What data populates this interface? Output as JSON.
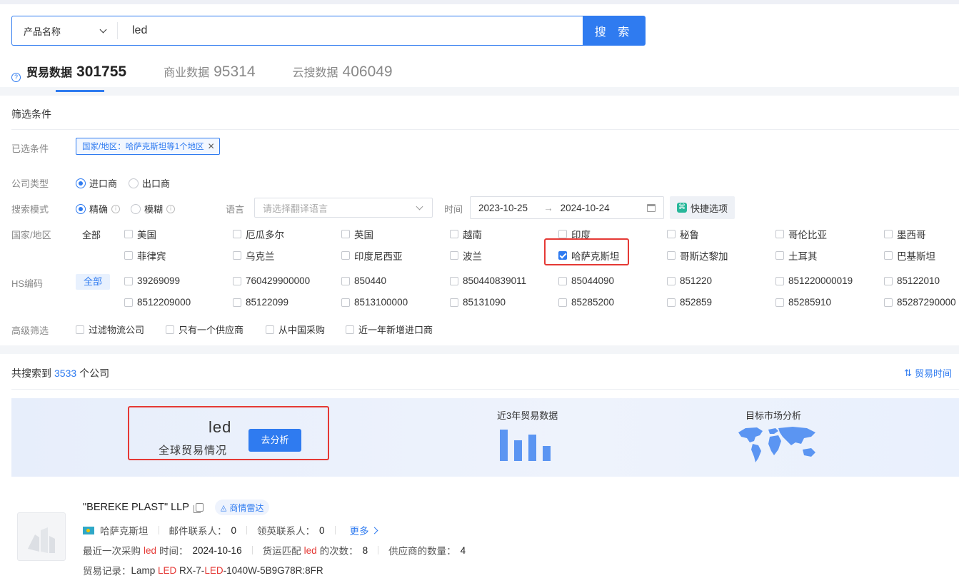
{
  "search": {
    "field_label": "产品名称",
    "query": "led",
    "button_label": "搜 索"
  },
  "tabs": [
    {
      "label": "贸易数据",
      "count": "301755"
    },
    {
      "label": "商业数据",
      "count": "95314"
    },
    {
      "label": "云搜数据",
      "count": "406049"
    }
  ],
  "filters": {
    "title": "筛选条件",
    "selected_label": "已选条件",
    "selected_chip": "国家/地区：哈萨克斯坦等1个地区",
    "company_type_label": "公司类型",
    "company_types": [
      "进口商",
      "出口商"
    ],
    "search_mode_label": "搜索模式",
    "search_modes": [
      "精确",
      "模糊"
    ],
    "language_label": "语言",
    "language_placeholder": "请选择翻译语言",
    "time_label": "时间",
    "date_from": "2023-10-25",
    "date_arrow": "→",
    "date_to": "2024-10-24",
    "quick_label": "快捷选项",
    "country_label": "国家/地区",
    "country_all": "全部",
    "countries": [
      "美国",
      "厄瓜多尔",
      "英国",
      "越南",
      "印度",
      "秘鲁",
      "哥伦比亚",
      "墨西哥",
      "菲律宾",
      "乌克兰",
      "印度尼西亚",
      "波兰",
      "哈萨克斯坦",
      "哥斯达黎加",
      "土耳其",
      "巴基斯坦"
    ],
    "checked_country": "哈萨克斯坦",
    "hs_label": "HS编码",
    "hs_all": "全部",
    "hs_codes": [
      "39269099",
      "760429900000",
      "850440",
      "850440839011",
      "85044090",
      "851220",
      "851220000019",
      "85122010",
      "8512209000",
      "85122099",
      "8513100000",
      "85131090",
      "85285200",
      "852859",
      "85285910",
      "85287290000"
    ],
    "advanced_label": "高级筛选",
    "advanced": [
      "过滤物流公司",
      "只有一个供应商",
      "从中国采购",
      "近一年新增进口商"
    ]
  },
  "results": {
    "count_prefix": "共搜索到",
    "count": "3533",
    "count_suffix": "个公司",
    "sort_label": "贸易时间",
    "banner": {
      "keyword": "led",
      "subtitle": "全球贸易情况",
      "analyze_button": "去分析",
      "trade_title": "近3年贸易数据",
      "market_title": "目标市场分析",
      "bar_levels": [
        0.95,
        0.62,
        0.8,
        0.45
      ]
    },
    "company": {
      "name": "\"BEREKE PLAST\" LLP",
      "radar_label": "商情雷达",
      "country": "哈萨克斯坦",
      "email_label": "邮件联系人：",
      "email_count": "0",
      "linkedin_label": "领英联系人：",
      "linkedin_count": "0",
      "more_label": "更多",
      "last_purchase_prefix": "最近一次采购",
      "keyword": "led",
      "last_purchase_suffix": "时间：",
      "last_purchase_date": "2024-10-16",
      "match_prefix": "货运匹配",
      "match_suffix": "的次数：",
      "match_count": "8",
      "supplier_label": "供应商的数量：",
      "supplier_count": "4",
      "trade_record_label": "贸易记录：",
      "trade_record_parts": [
        "Lamp ",
        "LED",
        " RX-7-",
        "LED",
        "-1040W-5B9G78R:8FR"
      ]
    }
  },
  "colors": {
    "accent": "#2f7bf0",
    "highlight": "#e53935",
    "annotation_box": "#e53935"
  }
}
